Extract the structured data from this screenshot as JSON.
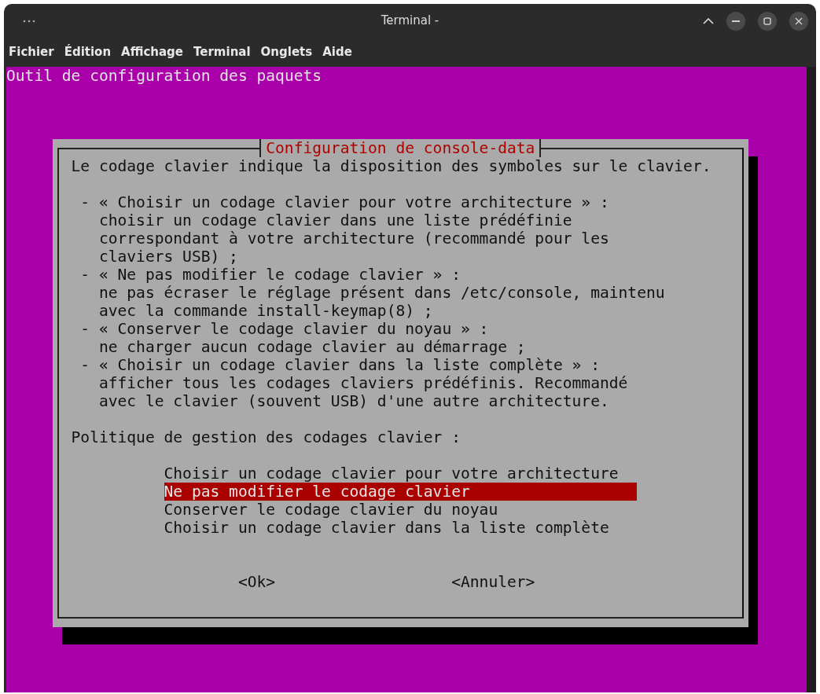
{
  "window": {
    "title": "Terminal -"
  },
  "menu": [
    "Fichier",
    "Édition",
    "Affichage",
    "Terminal",
    "Onglets",
    "Aide"
  ],
  "terminal": {
    "backtitle": "Outil de configuration des paquets",
    "dialog": {
      "title": "Configuration de console-data",
      "blocks": [
        {
          "lines": [
            {
              "kind": "text",
              "text": "Le codage clavier indique la disposition des symboles sur le clavier."
            }
          ]
        },
        {
          "lines": [
            {
              "kind": "bullet",
              "text": "- « Choisir un codage clavier pour votre architecture » :"
            },
            {
              "kind": "indent",
              "text": "choisir un codage clavier dans une liste prédéfinie"
            },
            {
              "kind": "indent",
              "text": "correspondant à votre architecture (recommandé pour les"
            },
            {
              "kind": "indent",
              "text": "claviers USB) ;"
            },
            {
              "kind": "bullet",
              "text": "- « Ne pas modifier le codage clavier » :"
            },
            {
              "kind": "indent",
              "text": "ne pas écraser le réglage présent dans /etc/console, maintenu"
            },
            {
              "kind": "indent",
              "text": "avec la commande install-keymap(8) ;"
            },
            {
              "kind": "bullet",
              "text": "- « Conserver le codage clavier du noyau » :"
            },
            {
              "kind": "indent",
              "text": "ne charger aucun codage clavier au démarrage ;"
            },
            {
              "kind": "bullet",
              "text": "- « Choisir un codage clavier dans la liste complète » :"
            },
            {
              "kind": "indent",
              "text": "afficher tous les codages claviers prédéfinis. Recommandé"
            },
            {
              "kind": "indent",
              "text": "avec le clavier (souvent USB) d'une autre architecture."
            }
          ]
        },
        {
          "lines": [
            {
              "kind": "text",
              "text": "Politique de gestion des codages clavier :"
            }
          ]
        }
      ],
      "options": [
        {
          "label": "Choisir un codage clavier pour votre architecture",
          "selected": false
        },
        {
          "label": "Ne pas modifier le codage clavier",
          "selected": true
        },
        {
          "label": "Conserver le codage clavier du noyau",
          "selected": false
        },
        {
          "label": "Choisir un codage clavier dans la liste complète",
          "selected": false
        }
      ],
      "buttons": [
        "<Ok>",
        "<Annuler>"
      ]
    }
  }
}
